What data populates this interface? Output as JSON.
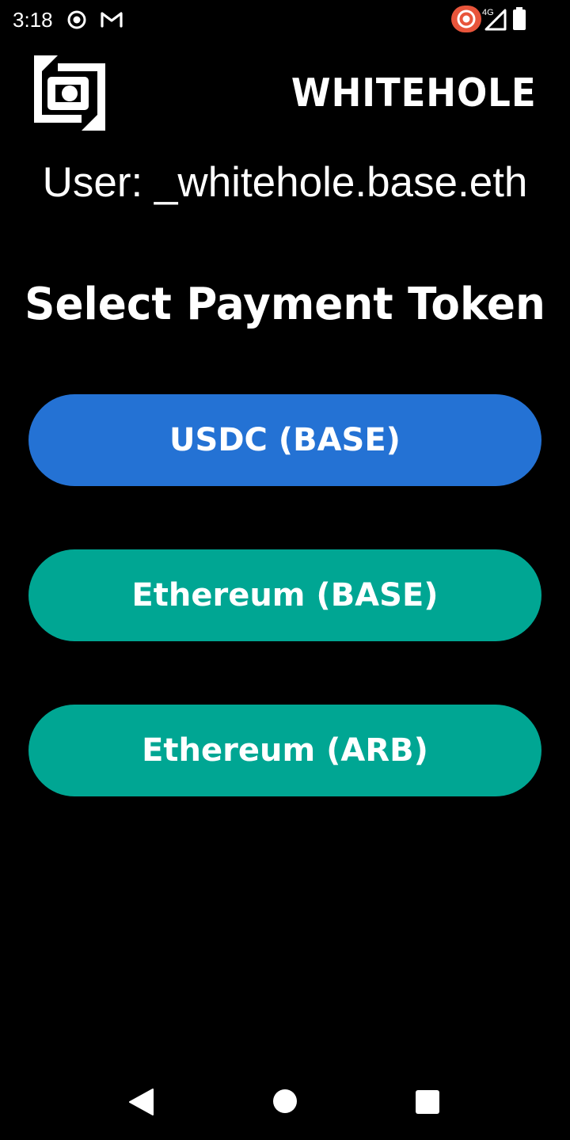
{
  "status_bar": {
    "time": "3:18",
    "network_type": "4G",
    "icons": [
      "radio-target-icon",
      "gmail-icon",
      "recording-icon",
      "signal-icon",
      "battery-icon"
    ]
  },
  "header": {
    "logo_icon": "whitehole-logo-icon",
    "brand": "WHITEHOLE"
  },
  "user": {
    "label": "User: _whitehole.base.eth"
  },
  "payment": {
    "title": "Select Payment Token",
    "tokens": [
      {
        "label": "USDC (BASE)",
        "color": "#2472D4"
      },
      {
        "label": "Ethereum (BASE)",
        "color": "#00A693"
      },
      {
        "label": "Ethereum (ARB)",
        "color": "#00A693"
      }
    ]
  },
  "nav_bar": {
    "icons": [
      "back-icon",
      "home-icon",
      "recents-icon"
    ]
  },
  "colors": {
    "background": "#000000",
    "text": "#FFFFFF",
    "recording_badge": "#E8553B"
  }
}
